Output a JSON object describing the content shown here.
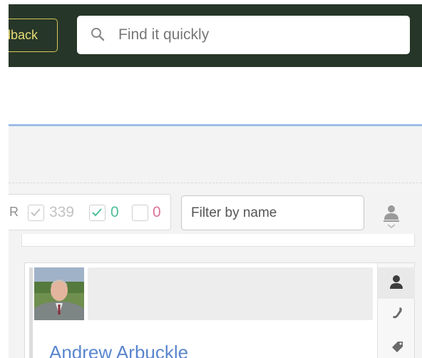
{
  "header": {
    "feedback_label": "dback",
    "search": {
      "placeholder": "Find it quickly",
      "icon": "search-icon"
    }
  },
  "filter_bar": {
    "count_prefix": "R",
    "counts": [
      {
        "state": "checked-grey",
        "value": "339",
        "color": "#c2c2c2"
      },
      {
        "state": "checked-green",
        "value": "0",
        "color": "#4cbf9a"
      },
      {
        "state": "unchecked",
        "value": "0",
        "color": "#e0739a"
      }
    ],
    "filter_placeholder": "Filter by name",
    "sort_icon": "person-sort-icon"
  },
  "contact_card": {
    "name": "Andrew Arbuckle",
    "tools": [
      "person-icon",
      "phone-icon",
      "tag-icon"
    ]
  },
  "colors": {
    "header_bg": "#263628",
    "feedback_accent": "#e9dc79",
    "blue_rule": "#9dbde8",
    "link_blue": "#5b86cf"
  }
}
